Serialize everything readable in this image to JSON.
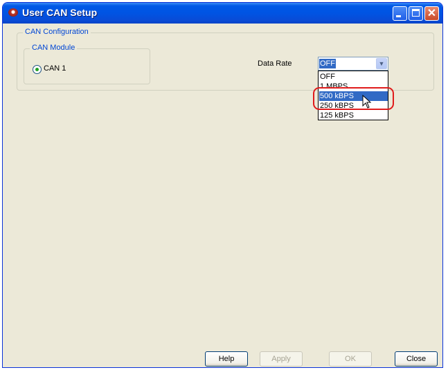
{
  "window": {
    "title": "User CAN Setup"
  },
  "can_configuration": {
    "legend": "CAN Configuration",
    "module": {
      "legend": "CAN Module",
      "radio_label": "CAN 1",
      "selected": true
    },
    "data_rate": {
      "label": "Data Rate",
      "current_value": "OFF",
      "options": [
        "OFF",
        "1 MBPS",
        "500 kBPS",
        "250 kBPS",
        "125 kBPS"
      ],
      "highlighted_option": "500 kBPS"
    }
  },
  "buttons": {
    "help": "Help",
    "apply": "Apply",
    "ok": "OK",
    "close": "Close"
  },
  "colors": {
    "title_bar": "#0054e3",
    "legend_text": "#0046d5",
    "selection": "#316ac5",
    "annotation_ring": "#e01b1b"
  }
}
